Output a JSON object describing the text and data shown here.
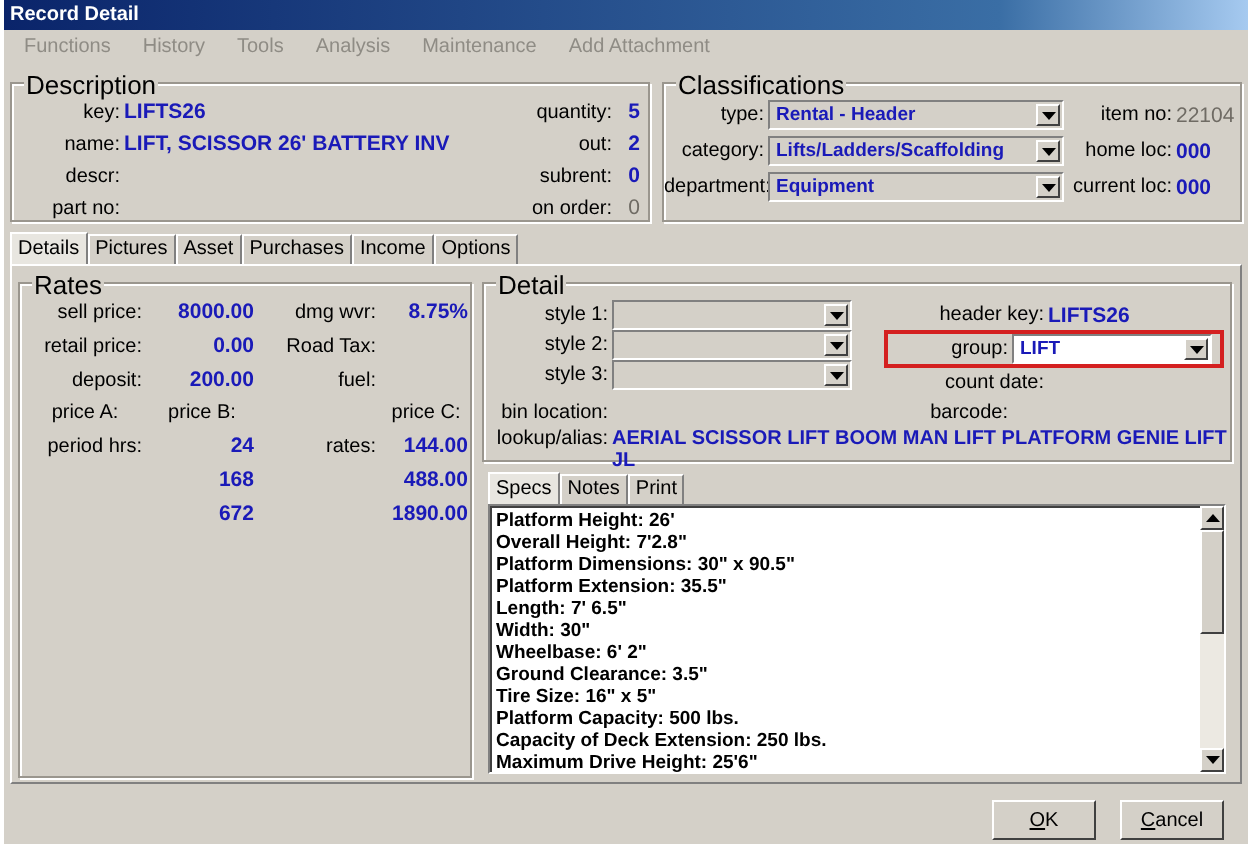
{
  "window": {
    "title": "Record Detail"
  },
  "menu": [
    {
      "label": "Functions",
      "disabled": true
    },
    {
      "label": "History",
      "disabled": true
    },
    {
      "label": "Tools",
      "disabled": true
    },
    {
      "label": "Analysis",
      "disabled": true
    },
    {
      "label": "Maintenance",
      "disabled": true
    },
    {
      "label": "Add Attachment",
      "disabled": true
    }
  ],
  "description": {
    "title": "Description",
    "fields": [
      {
        "label": "key:",
        "value": "LIFTS26"
      },
      {
        "label": "name:",
        "value": "LIFT, SCISSOR 26'  BATTERY INV"
      },
      {
        "label": "descr:"
      },
      {
        "label": "part no:"
      }
    ],
    "counts": [
      {
        "label": "quantity:",
        "value": "5",
        "disabled": false
      },
      {
        "label": "out:",
        "value": "2",
        "disabled": false
      },
      {
        "label": "subrent:",
        "value": "0",
        "disabled": false
      },
      {
        "label": "on order:",
        "value": "0",
        "disabled": true
      }
    ]
  },
  "classifications": {
    "title": "Classifications",
    "selects": [
      {
        "label": "type:",
        "value": "Rental - Header"
      },
      {
        "label": "category:",
        "value": "Lifts/Ladders/Scaffolding"
      },
      {
        "label": "department:",
        "value": "Equipment"
      }
    ],
    "info": [
      {
        "label": "item no:",
        "value": "22104",
        "disabled": true
      },
      {
        "label": "home loc:",
        "value": "000",
        "disabled": false
      },
      {
        "label": "current loc:",
        "value": "000",
        "disabled": false
      }
    ]
  },
  "tabs": [
    {
      "label": "Details",
      "selected": true
    },
    {
      "label": "Pictures",
      "selected": false
    },
    {
      "label": "Asset",
      "selected": false
    },
    {
      "label": "Purchases",
      "selected": false
    },
    {
      "label": "Income",
      "selected": false
    },
    {
      "label": "Options",
      "selected": false
    }
  ],
  "rates": {
    "title": "Rates",
    "rows": [
      [
        {
          "kind": "label",
          "text": "sell price:"
        },
        {
          "kind": "value",
          "text": "8000.00"
        },
        {
          "kind": "label",
          "text": "dmg wvr:"
        },
        {
          "kind": "value",
          "text": "8.75%"
        }
      ],
      [
        {
          "kind": "label",
          "text": "retail price:"
        },
        {
          "kind": "value",
          "text": "0.00"
        },
        {
          "kind": "label",
          "text": "Road Tax:"
        },
        {
          "kind": "blank"
        }
      ],
      [
        {
          "kind": "label",
          "text": "deposit:"
        },
        {
          "kind": "value",
          "text": "200.00"
        },
        {
          "kind": "label",
          "text": "fuel:"
        },
        {
          "kind": "blank"
        }
      ],
      [
        {
          "kind": "heading",
          "text": "price A:"
        },
        {
          "kind": "heading",
          "text": "price B:"
        },
        {
          "kind": "blank"
        },
        {
          "kind": "heading",
          "text": "price C:"
        }
      ],
      [
        {
          "kind": "label",
          "text": "period hrs:"
        },
        {
          "kind": "value",
          "text": "24"
        },
        {
          "kind": "label",
          "text": "rates:"
        },
        {
          "kind": "value",
          "text": "144.00"
        }
      ],
      [
        {
          "kind": "blank"
        },
        {
          "kind": "value",
          "text": "168"
        },
        {
          "kind": "blank"
        },
        {
          "kind": "value",
          "text": "488.00"
        }
      ],
      [
        {
          "kind": "blank"
        },
        {
          "kind": "value",
          "text": "672"
        },
        {
          "kind": "blank"
        },
        {
          "kind": "value",
          "text": "1890.00"
        }
      ]
    ]
  },
  "detail": {
    "title": "Detail",
    "styles": [
      {
        "label": "style 1:"
      },
      {
        "label": "style 2:"
      },
      {
        "label": "style 3:"
      }
    ],
    "header_key": {
      "label": "header key:",
      "value": "LIFTS26"
    },
    "group": {
      "label": "group:",
      "value": "LIFT",
      "highlighted": true
    },
    "count_date": {
      "label": "count date:"
    },
    "bin_location": {
      "label": "bin location:"
    },
    "barcode": {
      "label": "barcode:"
    },
    "lookup": {
      "label": "lookup/alias:",
      "value": "AERIAL SCISSOR LIFT BOOM MAN LIFT PLATFORM GENIE LIFT JL"
    }
  },
  "spec_tabs": [
    {
      "label": "Specs",
      "selected": true
    },
    {
      "label": "Notes",
      "selected": false
    },
    {
      "label": "Print",
      "selected": false
    }
  ],
  "specs": [
    "Platform Height: 26'",
    "Overall Height: 7'2.8\"",
    "Platform Dimensions: 30\" x 90.5\"",
    "Platform Extension: 35.5\"",
    "Length: 7' 6.5\"",
    "Width: 30\"",
    "Wheelbase: 6' 2\"",
    "Ground Clearance: 3.5\"",
    "Tire Size: 16\" x 5\"",
    "Platform Capacity: 500 lbs.",
    "Capacity of Deck Extension: 250 lbs.",
    "Maximum Drive Height: 25'6\""
  ],
  "buttons": [
    "OK",
    "Cancel"
  ]
}
